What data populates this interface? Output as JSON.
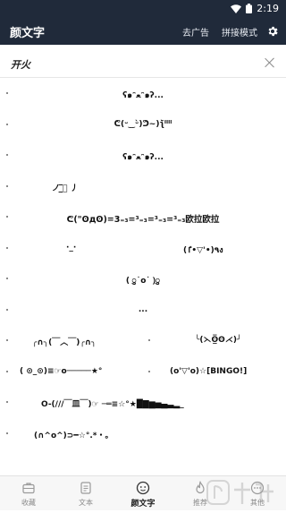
{
  "status_bar": {
    "time": "2:19"
  },
  "app_bar": {
    "title": "颜文字",
    "actions": [
      "去广告",
      "拼接模式"
    ]
  },
  "section": {
    "title": "开火"
  },
  "kaomoji": [
    [
      "ʕ๑ᵔﻌᵔ๑ʔ..."
    ],
    [
      "ᕦ(ᵕ‿ᵕ̀)ᕤ~)ʅ̃̀ᴵᴵᴵᴵ"
    ],
    [
      "ʕ๑ᵔﻌᵔ๑ʔ..."
    ],
    [
      "ノ ۞̲̲̅̅ 丿"
    ],
    [
      "ᕦ(\"ʘдʘ)=3₌₃=³₌₃=³₌₃=³₌₃欧拉欧拉"
    ],
    [
      "·_·",
      "٩(•'▽•ٵ)ง"
    ],
    [
      "( ु˙o˙ )ु"
    ],
    [
      "..."
    ],
    [
      "╭∩╮(￣︿￣)╭∩╮",
      "╰(⋋ʘ̲̅ʘ⋌)╯"
    ],
    [
      "( ⊙_⊙)≡☞o─────★°",
      "(o'▽'o)☆[BINGO!]"
    ],
    [
      "O-(///￣皿￣)☞ ─═≡☆°★█▇▆▅▄▃▂_"
    ],
    [
      "(∩^o^)⊃━☆°.*・。"
    ]
  ],
  "tabs": [
    {
      "label": "收藏",
      "icon": "briefcase-icon"
    },
    {
      "label": "文本",
      "icon": "document-icon"
    },
    {
      "label": "颜文字",
      "icon": "face-icon",
      "active": true
    },
    {
      "label": "推荐",
      "icon": "flame-icon"
    },
    {
      "label": "其他",
      "icon": "more-icon"
    }
  ]
}
